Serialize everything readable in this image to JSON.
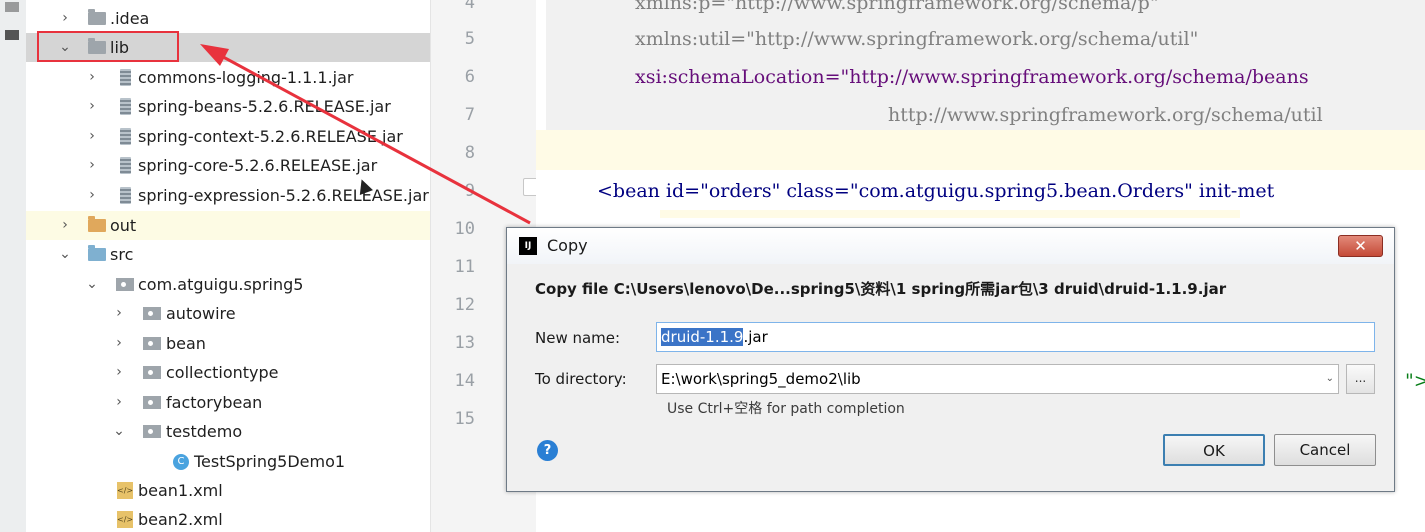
{
  "tree": {
    "rows": [
      {
        "label": ".idea",
        "icon": "folder-icon"
      },
      {
        "label": "lib",
        "icon": "folder-icon"
      },
      {
        "label": "commons-logging-1.1.1.jar",
        "icon": "jar-icon"
      },
      {
        "label": "spring-beans-5.2.6.RELEASE.jar",
        "icon": "jar-icon"
      },
      {
        "label": "spring-context-5.2.6.RELEASE.jar",
        "icon": "jar-icon"
      },
      {
        "label": "spring-core-5.2.6.RELEASE.jar",
        "icon": "jar-icon"
      },
      {
        "label": "spring-expression-5.2.6.RELEASE.jar",
        "icon": "jar-icon"
      },
      {
        "label": "out",
        "icon": "folder-icon"
      },
      {
        "label": "src",
        "icon": "folder-icon"
      },
      {
        "label": "com.atguigu.spring5",
        "icon": "package-icon"
      },
      {
        "label": "autowire",
        "icon": "package-icon"
      },
      {
        "label": "bean",
        "icon": "package-icon"
      },
      {
        "label": "collectiontype",
        "icon": "package-icon"
      },
      {
        "label": "factorybean",
        "icon": "package-icon"
      },
      {
        "label": "testdemo",
        "icon": "package-icon"
      },
      {
        "label": "TestSpring5Demo1",
        "icon": "class-icon"
      },
      {
        "label": "bean1.xml",
        "icon": "xml-file-icon"
      },
      {
        "label": "bean2.xml",
        "icon": "xml-file-icon"
      }
    ]
  },
  "gutter": {
    "line_numbers": [
      "4",
      "5",
      "6",
      "7",
      "8",
      "9",
      "10",
      "11",
      "12",
      "13",
      "14",
      "15"
    ]
  },
  "editor": {
    "lines": [
      "xmlns:p=\"http://www.springframework.org/schema/p\"",
      "xmlns:util=\"http://www.springframework.org/schema/util\"",
      "xsi:schemaLocation=\"http://www.springframework.org/schema/beans",
      "http://www.springframework.org/schema/util",
      "<bean id=\"orders\" class=\"com.atguigu.spring5.bean.Orders\" init-met"
    ],
    "trailing_fragment": "\">"
  },
  "dialog": {
    "title": "Copy",
    "heading": "Copy file C:\\Users\\lenovo\\De...spring5\\资料\\1 spring所需jar包\\3 druid\\druid-1.1.9.jar",
    "new_name_label": "New name:",
    "new_name_selected": "druid-1.1.9",
    "new_name_rest": ".jar",
    "to_directory_label": "To directory:",
    "to_directory_value": "E:\\work\\spring5_demo2\\lib",
    "browse_label": "...",
    "hint": "Use Ctrl+空格 for path completion",
    "ok_label": "OK",
    "cancel_label": "Cancel",
    "help_label": "?",
    "close_label": "✕",
    "app_icon_label": "IJ"
  },
  "colors": {
    "annotation_red": "#e8323d",
    "selection_blue": "#3b74c7",
    "string_green": "#067d17"
  }
}
